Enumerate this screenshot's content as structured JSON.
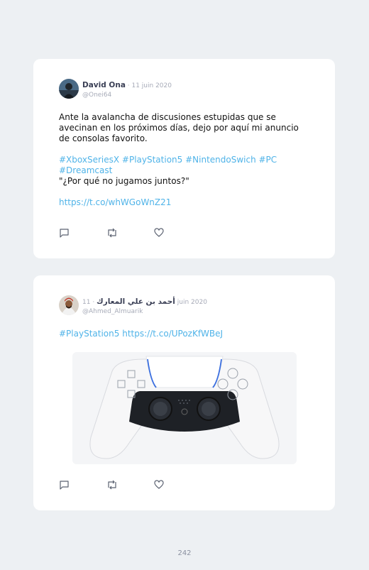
{
  "tweets": [
    {
      "author_name": "David Ona",
      "date": " · 11 juin 2020",
      "handle": "@Onei64",
      "text_line1": "Ante la avalancha de discusiones estupidas que se avecinan en los próximos días, dejo por aquí mi anuncio de consolas favorito.",
      "hashtags_line1": "#XboxSeriesX #PlayStation5 #NintendoSwich #PC",
      "hashtags_line2": "#Dreamcast",
      "quote": "\"¿Por qué no jugamos juntos?\"",
      "link": "https://t.co/whWGoWnZ21"
    },
    {
      "author_name": "أحمد بن علي المعارك",
      "date": " · 11 juin 2020",
      "handle": "@Ahmed_Almuarik",
      "hashtag": "#PlayStation5",
      "link": "https://t.co/UPozKfWBeJ",
      "media_subject": "ps5-dualsense-controller"
    }
  ],
  "page_number": "242",
  "colors": {
    "link": "#4fb3e8",
    "background": "#edf0f3",
    "card": "#ffffff"
  }
}
